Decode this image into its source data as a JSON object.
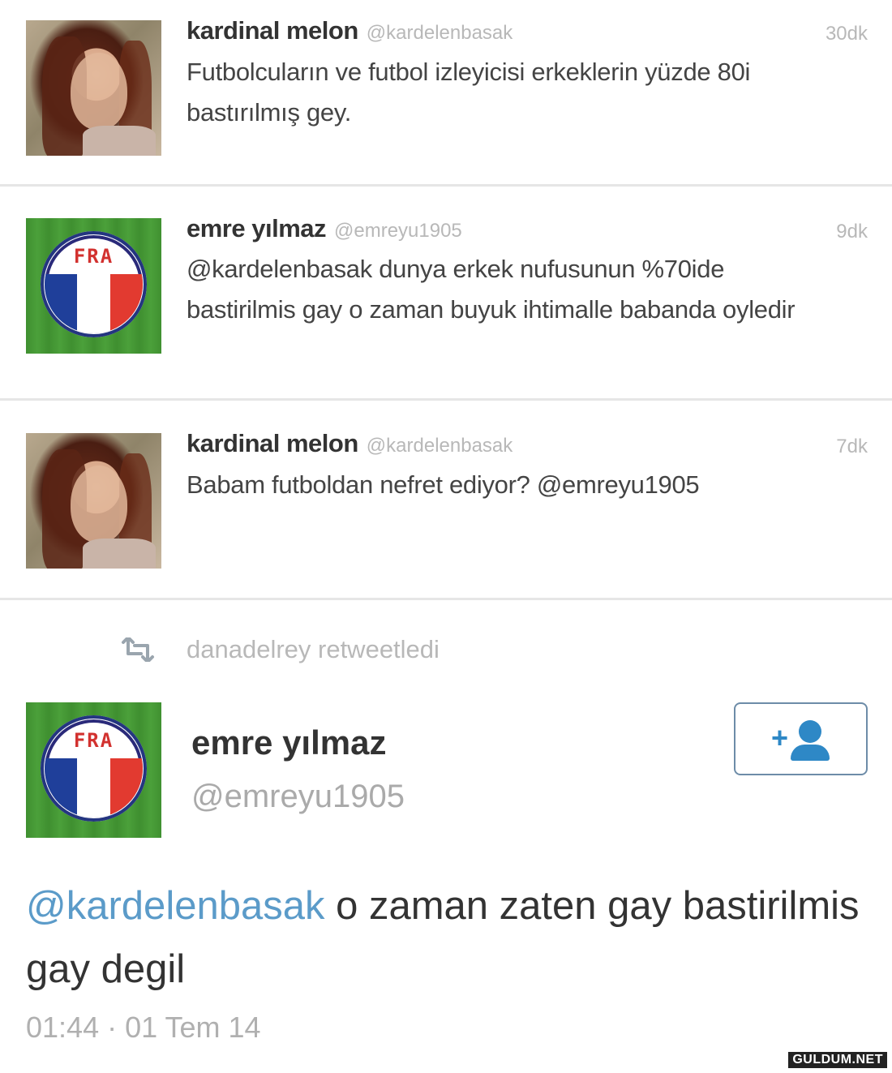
{
  "tweets": [
    {
      "name": "kardinal melon",
      "handle": "@kardelenbasak",
      "time": "30dk",
      "avatar": "profile-photo",
      "text": "Futbolcuların ve futbol izleyicisi erkeklerin yüzde 80i bastırılmış gey."
    },
    {
      "name": "emre yılmaz",
      "handle": "@emreyu1905",
      "time": "9dk",
      "avatar": "fra-badge",
      "text": "@kardelenbasak dunya erkek nufusunun %70ide bastirilmis gay o zaman buyuk ihtimalle babanda oyledir"
    },
    {
      "name": "kardinal melon",
      "handle": "@kardelenbasak",
      "time": "7dk",
      "avatar": "profile-photo",
      "text": "Babam futboldan nefret ediyor? @emreyu1905"
    }
  ],
  "retweet": {
    "icon": "retweet-icon",
    "label": "danadelrey retweetledi"
  },
  "detail": {
    "name": "emre yılmaz",
    "handle": "@emreyu1905",
    "follow_icon": "add-user-icon",
    "follow_plus": "+",
    "mention": "@kardelenbasak",
    "text": " o zaman zaten gay bastirilmis gay degil",
    "timestamp": "01:44 · 01 Tem 14",
    "fra_label": "FRA"
  },
  "watermark": "GULDUM.NET",
  "colors": {
    "mention": "#5b9bc9",
    "follow_accent": "#2e88c6",
    "muted": "#b8b8b8"
  }
}
